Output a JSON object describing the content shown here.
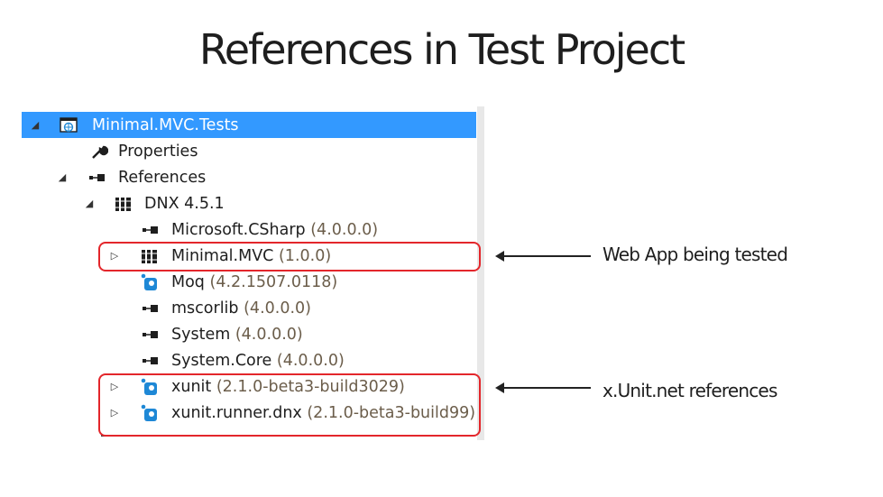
{
  "slide": {
    "title": "References in Test Project"
  },
  "tree": {
    "project": {
      "label": "Minimal.MVC.Tests",
      "icon": "web-project-icon",
      "expander": "expanded"
    },
    "properties": {
      "label": "Properties",
      "icon": "wrench-icon"
    },
    "references": {
      "label": "References",
      "icon": "reference-icon",
      "expander": "expanded"
    },
    "framework": {
      "label": "DNX 4.5.1",
      "icon": "library-icon",
      "expander": "expanded"
    },
    "items": [
      {
        "name": "Microsoft.CSharp",
        "version": "(4.0.0.0)",
        "icon": "reference-icon",
        "expander": ""
      },
      {
        "name": "Minimal.MVC",
        "version": "(1.0.0)",
        "icon": "library-icon",
        "expander": "collapsed"
      },
      {
        "name": "Moq",
        "version": "(4.2.1507.0118)",
        "icon": "nuget-package-icon",
        "expander": ""
      },
      {
        "name": "mscorlib",
        "version": "(4.0.0.0)",
        "icon": "reference-icon",
        "expander": ""
      },
      {
        "name": "System",
        "version": "(4.0.0.0)",
        "icon": "reference-icon",
        "expander": ""
      },
      {
        "name": "System.Core",
        "version": "(4.0.0.0)",
        "icon": "reference-icon",
        "expander": ""
      },
      {
        "name": "xunit",
        "version": "(2.1.0-beta3-build3029)",
        "icon": "nuget-package-icon",
        "expander": "collapsed"
      },
      {
        "name": "xunit.runner.dnx",
        "version": "(2.1.0-beta3-build99)",
        "icon": "nuget-package-icon",
        "expander": "collapsed"
      }
    ]
  },
  "annotations": {
    "web_app": "Web App being tested",
    "xunit": "x.Unit.net references"
  },
  "colors": {
    "selection": "#3399ff",
    "callout": "#e3262b",
    "package_icon": "#1e88d6"
  }
}
